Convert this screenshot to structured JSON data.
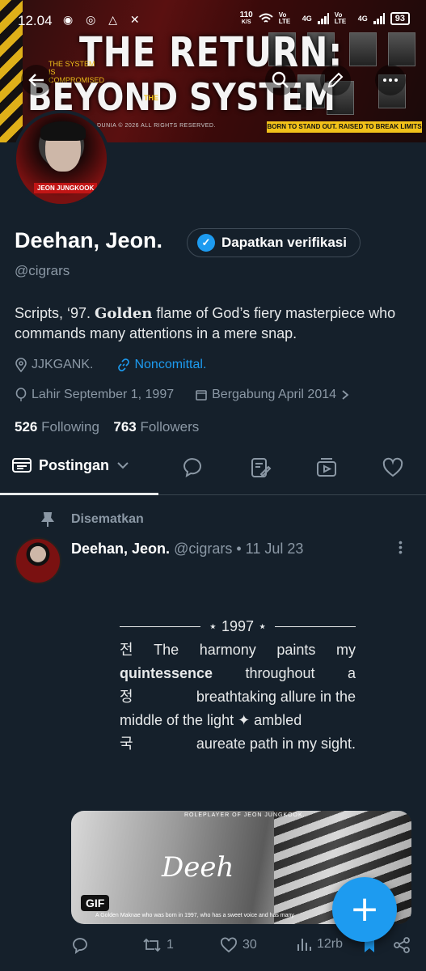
{
  "status_bar": {
    "time": "12.04",
    "speed": "110",
    "speed_unit": "K/S",
    "net1": "Vo LTE",
    "net1_type": "4G",
    "net2": "Vo LTE",
    "net2_type": "4G",
    "battery": "93"
  },
  "banner": {
    "title_line1": "THE RETURN:",
    "title_line2": "BEYOND SYSTEM",
    "title_the": "THE",
    "small_text": "THE SYSTEM IS COMPROMISED",
    "rights": "DUNIA © 2026 ALL RIGHTS RESERVED.",
    "tagline": "BORN TO STAND OUT. RAISED TO BREAK LIMITS"
  },
  "avatar": {
    "label": "JEON JUNGKOOK"
  },
  "profile": {
    "name": "Deehan, Jeon.",
    "verify_label": "Dapatkan verifikasi",
    "handle": "@cigrars",
    "bio_part1": "Scripts, ‘97. ",
    "bio_golden": "Golden",
    "bio_part2": " flame of God’s fiery masterpiece who commands many attentions in a mere snap.",
    "location": "JJKGANK.",
    "website": "Noncomittal.",
    "birth": "Lahir September 1, 1997",
    "joined": "Bergabung April 2014",
    "following_count": "526",
    "following_label": "Following",
    "followers_count": "763",
    "followers_label": "Followers"
  },
  "tabs": {
    "active_label": "Postingan"
  },
  "tweet": {
    "pinned_label": "Disematkan",
    "author": "Deehan, Jeon.",
    "handle_date": "@cigrars • 11 Jul 23",
    "poem_title": "⋆ 1997 ⋆",
    "poem": {
      "l1_c": "전",
      "l1_a": "The",
      "l1_b": "harmony",
      "l1_d": "paints",
      "l1_e": "my",
      "l2_bold": "quintessence",
      "l2_a": "throughout",
      "l2_b": "a",
      "l3_c": "정",
      "l3_text": "breathtaking allure in the",
      "l4_text": "middle of the light ✦ ambled",
      "l5_c": "국",
      "l5_text": "aureate path in my sight."
    },
    "media": {
      "caption_top": "ROLEPLAYER OF JEON JUNGKOOK.",
      "script": "Deeh",
      "caption_bottom": "A Golden Maknae who was born in 1997, who has a sweet voice and has many",
      "gif_label": "GIF"
    },
    "retweets": "1",
    "likes": "30",
    "views": "12rb"
  },
  "colors": {
    "background": "#15202b",
    "accent": "#1d9bf0",
    "muted": "#8b98a5"
  }
}
